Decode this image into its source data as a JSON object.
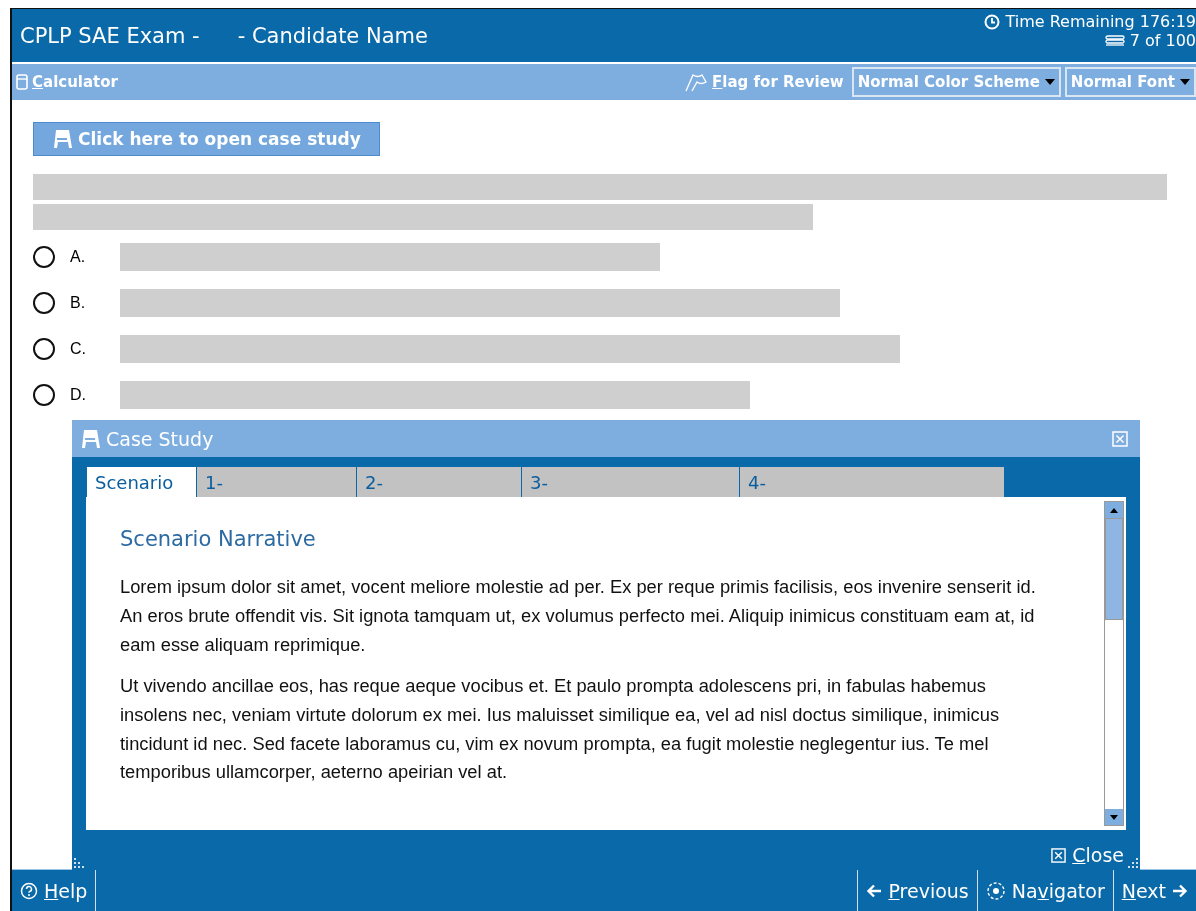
{
  "header": {
    "title": "CPLP SAE Exam -",
    "candidate": "- Candidate Name",
    "time_remaining": "Time Remaining 176:19",
    "progress": "7 of 100"
  },
  "toolbar": {
    "calculator": {
      "key": "C",
      "after": "alculator"
    },
    "flag": {
      "key": "F",
      "after": "lag for Review",
      "selected": false
    },
    "color_scheme": "Normal Color Scheme",
    "font": "Normal Font"
  },
  "case_study_button": "Click here to open case study",
  "question": {
    "options": [
      {
        "letter": "A.",
        "selected": false
      },
      {
        "letter": "B.",
        "selected": false
      },
      {
        "letter": "C.",
        "selected": false
      },
      {
        "letter": "D.",
        "selected": false
      }
    ]
  },
  "case_study": {
    "title": "Case Study",
    "tabs": [
      {
        "label": "Scenario",
        "selected": true
      },
      {
        "label": "1-",
        "selected": false
      },
      {
        "label": "2-",
        "selected": false
      },
      {
        "label": "3-",
        "selected": false
      },
      {
        "label": "4-",
        "selected": false
      }
    ],
    "heading": "Scenario Narrative",
    "paragraphs": [
      "Lorem ipsum dolor sit amet, vocent meliore molestie ad per. Ex per reque primis facilisis, eos invenire senserit id. An eros brute offendit vis. Sit ignota tamquam ut, ex volumus perfecto mei. Aliquip inimicus constituam eam at, id eam esse aliquam reprimique.",
      "Ut vivendo ancillae eos, has reque aeque vocibus et. Et paulo prompta adolescens pri, in fabulas habemus insolens nec, veniam virtute dolorum ex mei. Ius maluisset similique ea, vel ad nisl doctus similique, inimicus tincidunt id nec. Sed facete laboramus cu, vim ex novum prompta, ea fugit molestie neglegentur ius. Te mel temporibus ullamcorper, aeterno apeirian vel at."
    ],
    "close": {
      "key": "C",
      "after": "lose"
    }
  },
  "footer": {
    "help": {
      "key": "H",
      "after": "elp"
    },
    "previous": {
      "key": "P",
      "after": "revious"
    },
    "navigator": {
      "before": "Na",
      "key": "v",
      "after": "igator"
    },
    "next": {
      "key": "N",
      "after": "ext"
    }
  }
}
